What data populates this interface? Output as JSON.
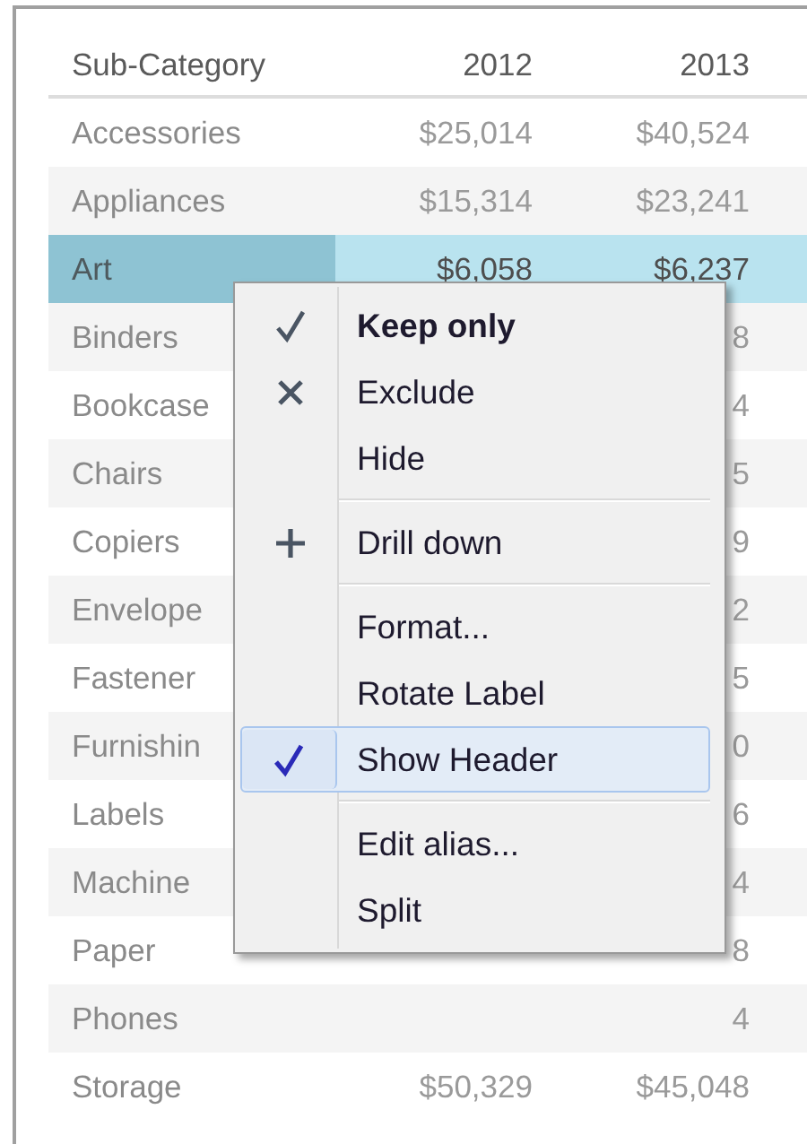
{
  "table": {
    "columns": [
      "Sub-Category",
      "2012",
      "2013"
    ],
    "rows": [
      {
        "name": "Accessories",
        "v2012": "$25,014",
        "v2013": "$40,524",
        "selected": false
      },
      {
        "name": "Appliances",
        "v2012": "$15,314",
        "v2013": "$23,241",
        "selected": false
      },
      {
        "name": "Art",
        "v2012": "$6,058",
        "v2013": "$6,237",
        "selected": true
      },
      {
        "name": "Binders",
        "v2013": "8",
        "selected": false
      },
      {
        "name": "Bookcase",
        "v2013": "4",
        "selected": false
      },
      {
        "name": "Chairs",
        "v2013": "5",
        "selected": false
      },
      {
        "name": "Copiers",
        "v2013": "9",
        "selected": false
      },
      {
        "name": "Envelope",
        "v2013": "2",
        "selected": false
      },
      {
        "name": "Fastener",
        "v2013": "5",
        "selected": false
      },
      {
        "name": "Furnishin",
        "v2013": "0",
        "selected": false
      },
      {
        "name": "Labels",
        "v2013": "6",
        "selected": false
      },
      {
        "name": "Machine",
        "v2013": "4",
        "selected": false
      },
      {
        "name": "Paper",
        "v2013": "8",
        "selected": false
      },
      {
        "name": "Phones",
        "v2013": "4",
        "selected": false
      },
      {
        "name": "Storage",
        "v2012": "$50,329",
        "v2013": "$45,048",
        "selected": false
      }
    ]
  },
  "context_menu": {
    "groups": [
      [
        {
          "label": "Keep only",
          "kind": "check",
          "default": true,
          "checked": false,
          "selected": false
        },
        {
          "label": "Exclude",
          "kind": "cross",
          "default": false,
          "checked": false,
          "selected": false
        },
        {
          "label": "Hide",
          "kind": "plain",
          "default": false,
          "checked": false,
          "selected": false
        }
      ],
      [
        {
          "label": "Drill down",
          "kind": "plus",
          "default": false,
          "checked": false,
          "selected": false
        }
      ],
      [
        {
          "label": "Format...",
          "kind": "plain",
          "default": false,
          "checked": false,
          "selected": false
        },
        {
          "label": "Rotate Label",
          "kind": "plain",
          "default": false,
          "checked": false,
          "selected": false
        },
        {
          "label": "Show Header",
          "kind": "plain",
          "default": false,
          "checked": true,
          "selected": true
        }
      ],
      [
        {
          "label": "Edit alias...",
          "kind": "plain",
          "default": false,
          "checked": false,
          "selected": false
        },
        {
          "label": "Split",
          "kind": "plain",
          "default": false,
          "checked": false,
          "selected": false
        }
      ]
    ]
  }
}
